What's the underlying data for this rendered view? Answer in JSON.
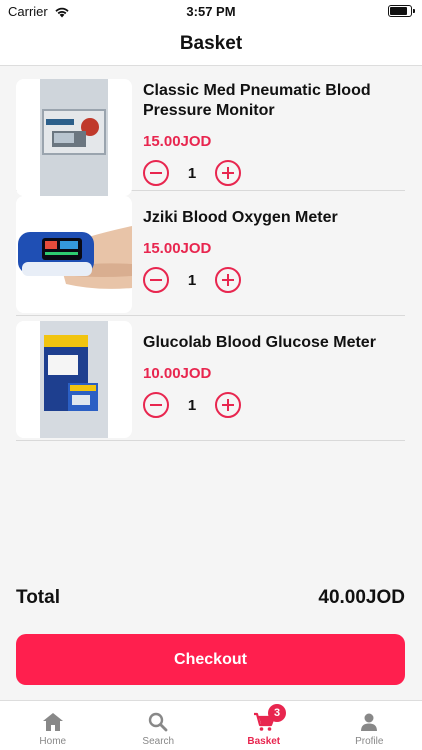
{
  "status_bar": {
    "carrier": "Carrier",
    "time": "3:57 PM",
    "battery_level": 0.9
  },
  "header": {
    "title": "Basket"
  },
  "items": [
    {
      "name": "Classic Med Pneumatic Blood Pressure Monitor",
      "price": "15.00JOD",
      "quantity": "1",
      "image": "blood-pressure-monitor-box"
    },
    {
      "name": "Jziki Blood Oxygen Meter",
      "price": "15.00JOD",
      "quantity": "1",
      "image": "finger-pulse-oximeter"
    },
    {
      "name": "Glucolab Blood Glucose Meter",
      "price": "10.00JOD",
      "quantity": "1",
      "image": "glucose-meter-box"
    }
  ],
  "summary": {
    "total_label": "Total",
    "total_value": "40.00JOD"
  },
  "checkout": {
    "label": "Checkout"
  },
  "tabbar": {
    "tabs": [
      {
        "label": "Home",
        "icon": "home-icon"
      },
      {
        "label": "Search",
        "icon": "search-icon"
      },
      {
        "label": "Basket",
        "icon": "cart-icon",
        "badge": "3",
        "active": true
      },
      {
        "label": "Profile",
        "icon": "person-icon"
      }
    ]
  },
  "colors": {
    "accent": "#e8264f",
    "button": "#ff1f4e",
    "background": "#f5f5f5"
  }
}
